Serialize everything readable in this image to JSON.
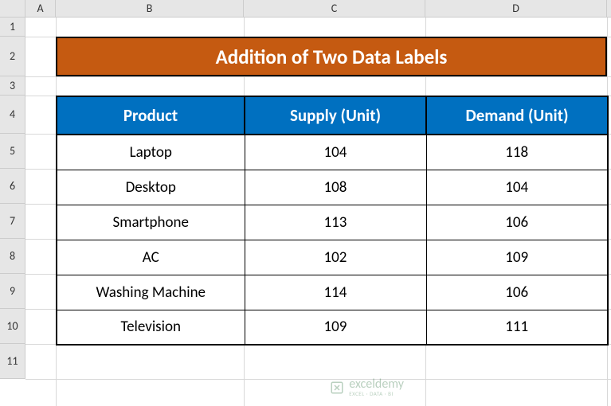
{
  "columns": [
    "A",
    "B",
    "C",
    "D"
  ],
  "rows": [
    "1",
    "2",
    "3",
    "4",
    "5",
    "6",
    "7",
    "8",
    "9",
    "10",
    "11"
  ],
  "title": "Addition of Two Data Labels",
  "headers": {
    "product": "Product",
    "supply": "Supply (Unit)",
    "demand": "Demand (Unit)"
  },
  "data": [
    {
      "product": "Laptop",
      "supply": "104",
      "demand": "118"
    },
    {
      "product": "Desktop",
      "supply": "108",
      "demand": "104"
    },
    {
      "product": "Smartphone",
      "supply": "113",
      "demand": "106"
    },
    {
      "product": "AC",
      "supply": "102",
      "demand": "109"
    },
    {
      "product": "Washing Machine",
      "supply": "114",
      "demand": "106"
    },
    {
      "product": "Television",
      "supply": "109",
      "demand": "111"
    }
  ],
  "watermark": {
    "main": "exceldemy",
    "sub": "EXCEL · DATA · BI"
  },
  "chart_data": {
    "type": "table",
    "title": "Addition of Two Data Labels",
    "columns": [
      "Product",
      "Supply (Unit)",
      "Demand (Unit)"
    ],
    "rows": [
      [
        "Laptop",
        104,
        118
      ],
      [
        "Desktop",
        108,
        104
      ],
      [
        "Smartphone",
        113,
        106
      ],
      [
        "AC",
        102,
        109
      ],
      [
        "Washing Machine",
        114,
        106
      ],
      [
        "Television",
        109,
        111
      ]
    ]
  }
}
